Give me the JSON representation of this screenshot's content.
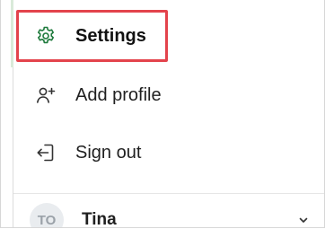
{
  "menu": {
    "items": [
      {
        "label": "Settings",
        "icon": "gear-icon",
        "selected": true
      },
      {
        "label": "Add profile",
        "icon": "add-person-icon",
        "selected": false
      },
      {
        "label": "Sign out",
        "icon": "sign-out-icon",
        "selected": false
      }
    ]
  },
  "profile": {
    "initials": "TO",
    "name": "Tina",
    "expand_icon": "chevron-down-icon"
  },
  "colors": {
    "accent_green": "#1e7a3c",
    "highlight_red": "#e3434c",
    "text": "#1f1f1f"
  }
}
